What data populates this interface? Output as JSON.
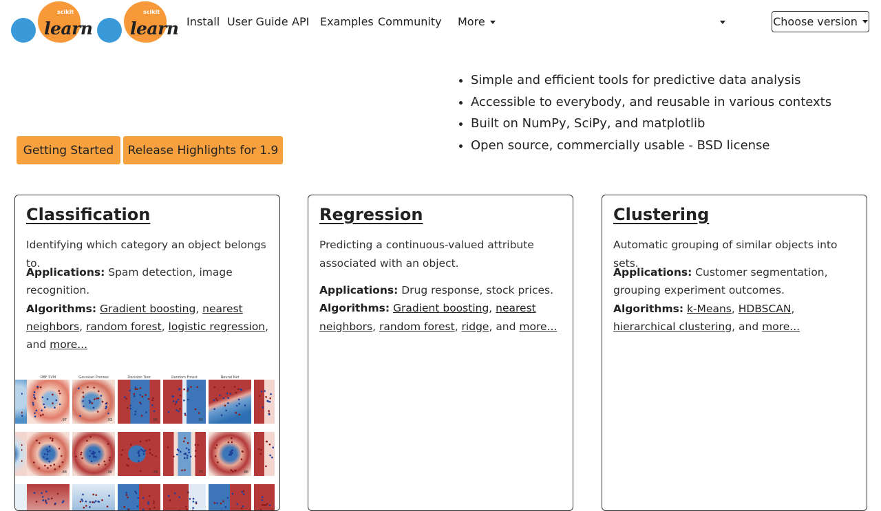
{
  "nav": {
    "logo_text": "learn",
    "logo_sub": "scikit",
    "links": [
      "Install",
      "User Guide",
      "API",
      "Examples",
      "Community"
    ],
    "more_label": "More",
    "version_label": "Choose version"
  },
  "hero": {
    "buttons": [
      "Getting Started",
      "Release Highlights for 1.9"
    ],
    "features": [
      "Simple and efficient tools for predictive data analysis",
      "Accessible to everybody, and reusable in various contexts",
      "Built on NumPy, SciPy, and matplotlib",
      "Open source, commercially usable - BSD license"
    ]
  },
  "cards": [
    {
      "title": "Classification",
      "description": "Identifying which category an object belongs to.",
      "applications_label": "Applications:",
      "applications": "Spam detection, image recognition.",
      "algorithms_label": "Algorithms:",
      "algorithms": [
        "Gradient boosting",
        "nearest neighbors",
        "random forest",
        "logistic regression"
      ],
      "and_text": "and",
      "more_link": "more..."
    },
    {
      "title": "Regression",
      "description": "Predicting a continuous-valued attribute associated with an object.",
      "applications_label": "Applications:",
      "applications": "Drug response, stock prices.",
      "algorithms_label": "Algorithms:",
      "algorithms": [
        "Gradient boosting",
        "nearest neighbors",
        "random forest",
        "ridge"
      ],
      "and_text": "and",
      "more_link": "more..."
    },
    {
      "title": "Clustering",
      "description": "Automatic grouping of similar objects into sets.",
      "applications_label": "Applications:",
      "applications": "Customer segmentation, grouping experiment outcomes.",
      "algorithms_label": "Algorithms:",
      "algorithms": [
        "k-Means",
        "HDBSCAN",
        "hierarchical clustering"
      ],
      "and_text": "and",
      "more_link": "more..."
    }
  ],
  "classifier_grid": {
    "column_titles": [
      "RBF SVM",
      "Gaussian Process",
      "Decision Tree",
      "Random Forest",
      "Neural Net"
    ],
    "scores": [
      ".88",
      ".97",
      ".93",
      ".95",
      ".90",
      ".40",
      ".88",
      ".90",
      ".78",
      ".75",
      ".88"
    ]
  },
  "colors": {
    "accent": "#f7a03e",
    "logo_orange": "#f89939",
    "logo_blue": "#3a9ad9",
    "class_red": "#c0392b",
    "class_blue": "#2c6fb3"
  }
}
